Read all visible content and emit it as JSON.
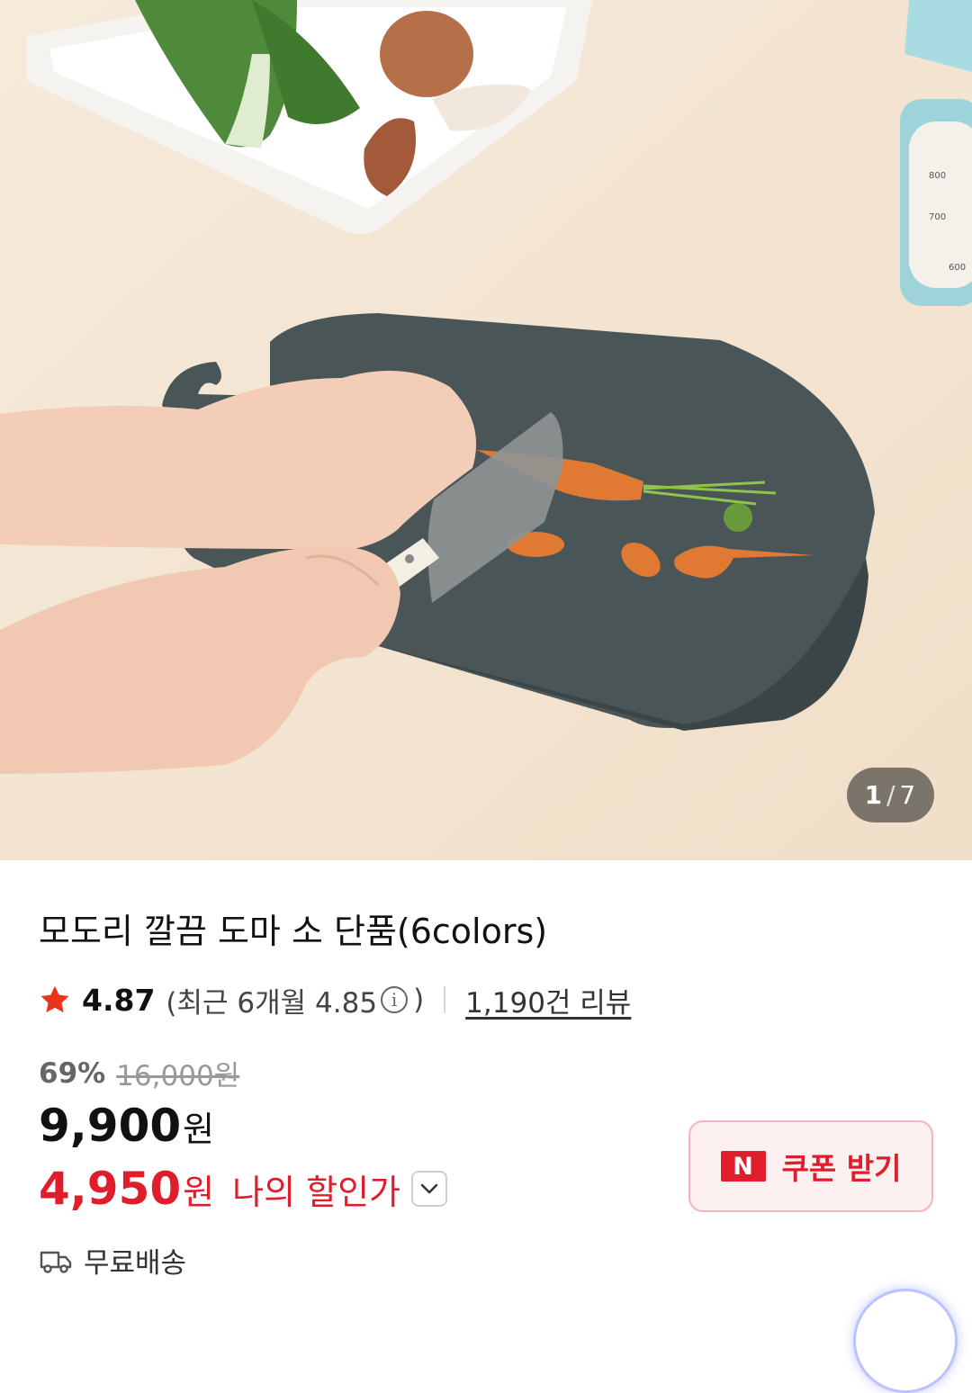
{
  "gallery": {
    "current": "1",
    "separator": "/",
    "total": "7",
    "image_alt": "dark cutting board with carrot and knife",
    "scale_ticks": [
      "800",
      "700",
      "600"
    ]
  },
  "product": {
    "title": "모도리 깔끔 도마 소 단품(6colors)",
    "rating": "4.87",
    "recent_prefix": "(최근 6개월 4.85",
    "recent_suffix": ")",
    "info_glyph": "i",
    "review_count": "1,190건 리뷰"
  },
  "pricing": {
    "discount_rate": "69%",
    "original_price": "16,000원",
    "price": "9,900",
    "currency": "원",
    "my_price": "4,950",
    "my_price_currency": "원",
    "my_price_label": "나의 할인가"
  },
  "coupon": {
    "logo": "N",
    "label": "쿠폰 받기"
  },
  "shipping": {
    "label": "무료배송"
  },
  "colors": {
    "accent": "#e01e2b",
    "star": "#e8341c",
    "coupon_bg": "#fdf0f1",
    "coupon_border": "#f2b6bc"
  }
}
